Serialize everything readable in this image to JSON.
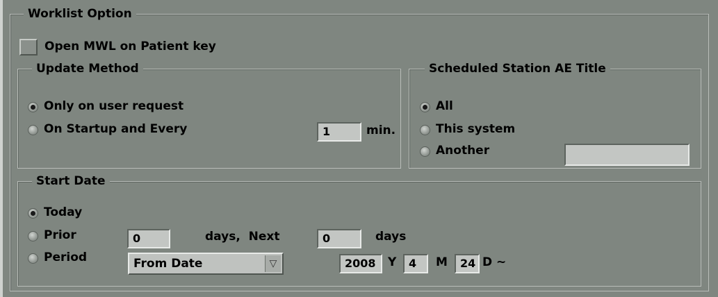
{
  "worklist": {
    "legend": "Worklist Option",
    "open_mwl_label": "Open MWL on Patient key",
    "open_mwl_checked": false
  },
  "update_method": {
    "legend": "Update Method",
    "option_user_request": "Only on user request",
    "option_startup": "On Startup and Every",
    "interval_value": "1",
    "interval_unit": "min.",
    "selected": "Only on user request"
  },
  "station": {
    "legend": "Scheduled Station AE Title",
    "option_all": "All",
    "option_this_system": "This system",
    "option_another": "Another",
    "another_value": "",
    "selected": "All"
  },
  "start_date": {
    "legend": "Start Date",
    "option_today": "Today",
    "option_prior": "Prior",
    "option_period": "Period",
    "selected": "Today",
    "prior_days": "0",
    "days_next_label": "days,  Next",
    "next_days": "0",
    "days_label": "days",
    "period_select": "From Date",
    "year": "2008",
    "year_unit": "Y",
    "month": "4",
    "month_unit": "M",
    "day": "24",
    "day_unit": "D ~"
  },
  "icons": {
    "dropdown": "▽"
  }
}
